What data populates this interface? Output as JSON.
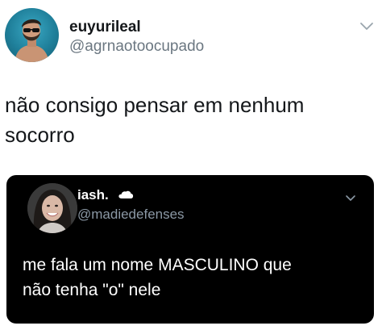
{
  "tweet": {
    "author": {
      "name": "euyurileal",
      "handle": "@agrnaotoocupado"
    },
    "text_lines": [
      "não consigo pensar em nenhum",
      "socorro"
    ]
  },
  "quoted_tweet": {
    "author": {
      "name": "iash.",
      "handle": "@madiedefenses",
      "emoji_icon": "cloud-icon"
    },
    "text_lines": [
      "me fala um nome MASCULINO que",
      "não tenha \"o\" nele"
    ]
  },
  "icons": {
    "menu": "chevron-down-icon"
  },
  "colors": {
    "primary_text": "#14171a",
    "secondary_text": "#6b7781",
    "quote_background": "#000000",
    "quote_text": "#ffffff",
    "quote_secondary_text": "#8b98a5"
  }
}
